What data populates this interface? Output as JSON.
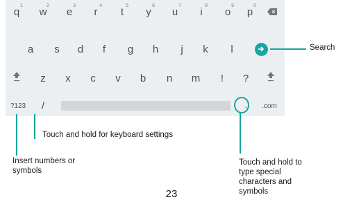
{
  "keyboard": {
    "row1": [
      {
        "key": "q",
        "hint": "1"
      },
      {
        "key": "w",
        "hint": "2"
      },
      {
        "key": "e",
        "hint": "3"
      },
      {
        "key": "r",
        "hint": "4"
      },
      {
        "key": "t",
        "hint": "5"
      },
      {
        "key": "y",
        "hint": "6"
      },
      {
        "key": "u",
        "hint": "7"
      },
      {
        "key": "i",
        "hint": "8"
      },
      {
        "key": "o",
        "hint": "9"
      },
      {
        "key": "p",
        "hint": "0"
      }
    ],
    "row2": [
      "a",
      "s",
      "d",
      "f",
      "g",
      "h",
      "j",
      "k",
      "l"
    ],
    "row3": [
      "z",
      "x",
      "c",
      "v",
      "b",
      "n",
      "m",
      "!",
      "?"
    ],
    "row4": {
      "symbols": "?123",
      "slash": "/",
      "period": ".",
      "com": ".com"
    },
    "icons": {
      "backspace": "backspace-icon",
      "enter": "arrow-right-icon",
      "shift": "shift-icon"
    },
    "accent_color": "#19a5a0"
  },
  "callouts": {
    "search": "Search",
    "keyboard_settings": "Touch and hold for keyboard settings",
    "insert_numbers": "Insert numbers or\nsymbols",
    "special_characters": "Touch and hold to\ntype special\ncharacters and\nsymbols"
  },
  "page_number": "23"
}
